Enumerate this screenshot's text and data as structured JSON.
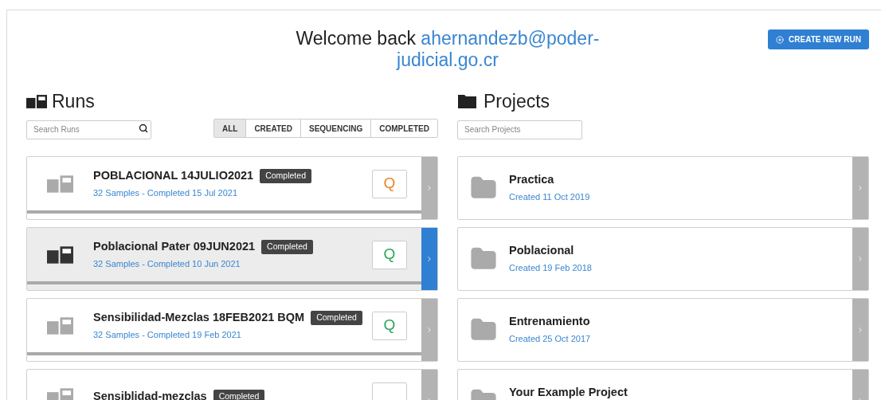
{
  "header": {
    "greeting": "Welcome back",
    "email": "ahernandezb@poder-judicial.go.cr",
    "create_button": "CREATE NEW RUN"
  },
  "runs": {
    "title": "Runs",
    "search": {
      "placeholder": "Search Runs"
    },
    "filters": [
      {
        "label": "ALL",
        "selected": true
      },
      {
        "label": "CREATED",
        "selected": false
      },
      {
        "label": "SEQUENCING",
        "selected": false
      },
      {
        "label": "COMPLETED",
        "selected": false
      }
    ],
    "items": [
      {
        "name": "POBLACIONAL 14JULIO2021",
        "status": "Completed",
        "subtitle": "32 Samples - Completed 15 Jul 2021",
        "q_label": "Q",
        "color": "#e8832a",
        "selected": false
      },
      {
        "name": "Poblacional Pater 09JUN2021",
        "status": "Completed",
        "subtitle": "32 Samples - Completed 10 Jun 2021",
        "q_label": "Q",
        "color": "#2aa55a",
        "selected": true
      },
      {
        "name": "Sensibilidad-Mezclas 18FEB2021 BQM",
        "status": "Completed",
        "subtitle": "32 Samples - Completed 19 Feb 2021",
        "q_label": "Q",
        "color": "#2aa55a",
        "selected": false
      },
      {
        "name": "Sensiblidad-mezclas",
        "status": "Completed",
        "selected": false
      }
    ]
  },
  "projects": {
    "title": "Projects",
    "search": {
      "placeholder": "Search Projects"
    },
    "items": [
      {
        "name": "Practica",
        "subtitle": "Created 11 Oct 2019"
      },
      {
        "name": "Poblacional",
        "subtitle": "Created 19 Feb 2018"
      },
      {
        "name": "Entrenamiento",
        "subtitle": "Created 25 Oct 2017"
      },
      {
        "name": "Your Example Project"
      }
    ]
  }
}
